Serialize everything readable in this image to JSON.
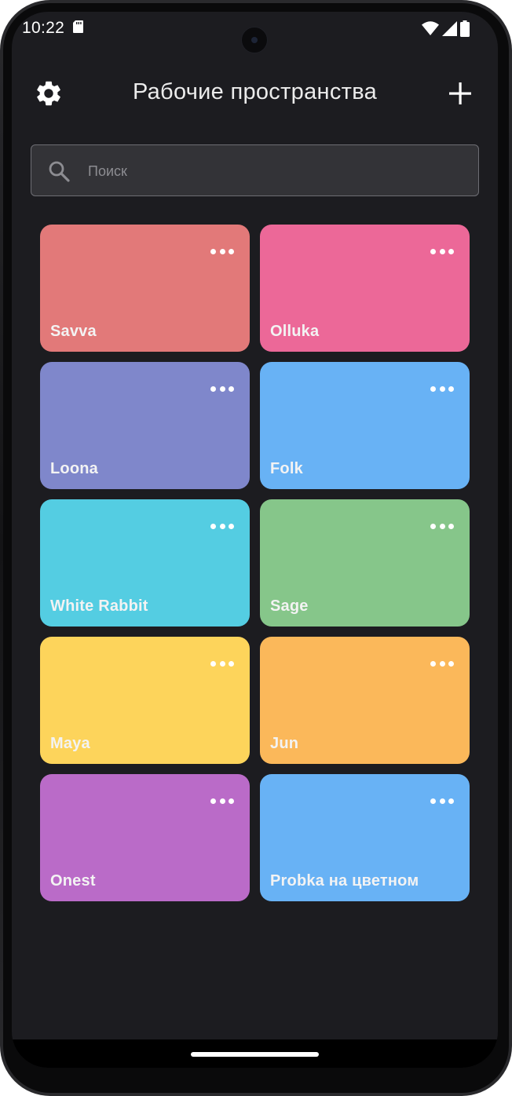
{
  "status_bar": {
    "time": "10:22"
  },
  "header": {
    "title": "Рабочие пространства"
  },
  "search": {
    "placeholder": "Поиск",
    "value": ""
  },
  "workspaces": [
    {
      "name": "Savva",
      "color": "#e27979"
    },
    {
      "name": "Olluka",
      "color": "#ec6898"
    },
    {
      "name": "Loona",
      "color": "#7f87cb"
    },
    {
      "name": "Folk",
      "color": "#68b2f5"
    },
    {
      "name": "White Rabbit",
      "color": "#54cde2"
    },
    {
      "name": "Sage",
      "color": "#86c68a"
    },
    {
      "name": "Maya",
      "color": "#fdd45b"
    },
    {
      "name": "Jun",
      "color": "#fbb85a"
    },
    {
      "name": "Onest",
      "color": "#ba6bc8"
    },
    {
      "name": "Probka на цветном",
      "color": "#68b2f5"
    }
  ],
  "icons": {
    "settings": "gear-icon",
    "add": "plus-icon",
    "search": "search-icon",
    "menu": "more-horizontal-icon"
  },
  "colors": {
    "background": "#1c1c20",
    "search_field": "#333337"
  }
}
